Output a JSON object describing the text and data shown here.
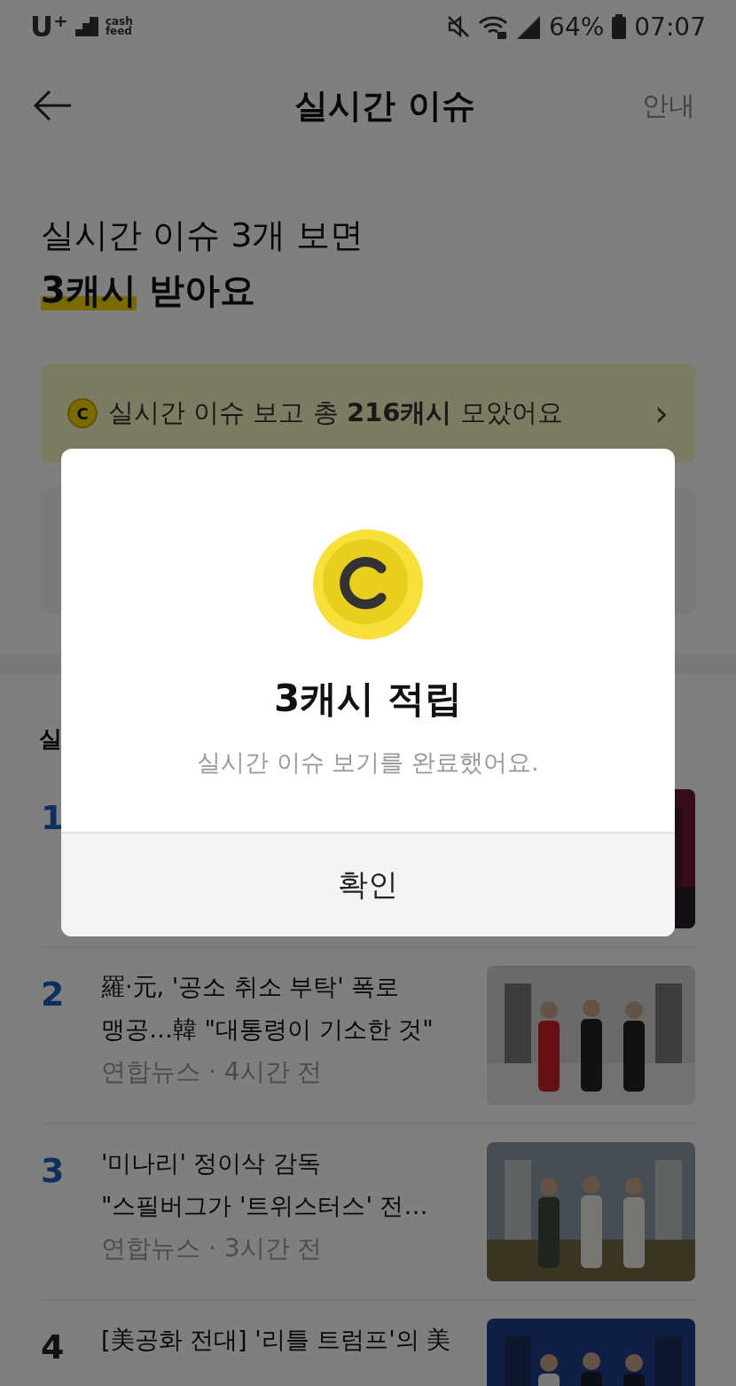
{
  "status_bar": {
    "carrier": "U⁺",
    "logo_text": [
      "cash",
      "feed"
    ],
    "battery": "64%",
    "time": "07:07"
  },
  "header": {
    "title": "실시간 이슈",
    "info_link": "안내"
  },
  "headline": {
    "line1": "실시간 이슈 3개 보면",
    "highlight": "3캐시",
    "rest": " 받아요"
  },
  "banner": {
    "coin": "C",
    "text": "실시간 이슈 보고 총 **216캐시** 모았어요",
    "chevron": "›"
  },
  "section_title": "실",
  "articles": [
    {
      "rank": "1",
      "top": true,
      "kind": "picture"
    },
    {
      "rank": "2",
      "top": true,
      "title_lines": [
        "羅·元, '공소 취소 부탁' 폭로",
        "맹공…韓 \"대통령이 기소한 것\""
      ],
      "source": "연합뉴스 · 4시간 전",
      "kind": "picture"
    },
    {
      "rank": "3",
      "top": true,
      "title_lines": [
        "'미나리' 정이삭 감독",
        "\"스필버그가 '트위스터스' 전…"
      ],
      "source": "연합뉴스 · 3시간 전",
      "kind": "picture"
    },
    {
      "rank": "4",
      "top": false,
      "title_lines": [
        "[美공화 전대] '리틀 트럼프'의 美"
      ],
      "kind": "picture"
    }
  ],
  "dialog": {
    "title": "3캐시 적립",
    "message": "실시간 이슈 보기를 완료했어요.",
    "button": "확인"
  }
}
